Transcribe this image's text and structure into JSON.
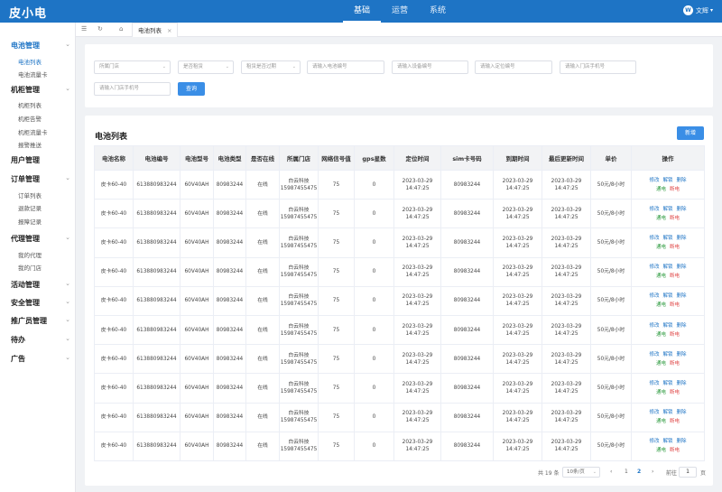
{
  "app": {
    "logo": "皮小电",
    "user": "文辉",
    "user_initial": "W"
  },
  "topnav": [
    "基础",
    "运营",
    "系统"
  ],
  "sidebar": {
    "groups": [
      {
        "label": "电池管理",
        "subs": [
          "电池列表",
          "电池流量卡"
        ]
      },
      {
        "label": "机柜管理",
        "subs": [
          "机柜列表",
          "机柜告警",
          "机柜流量卡",
          "报警推送"
        ]
      },
      {
        "label": "用户管理",
        "subs": []
      },
      {
        "label": "订单管理",
        "subs": [
          "订单列表",
          "退款记录",
          "报障记录"
        ]
      },
      {
        "label": "代理管理",
        "subs": [
          "我的代理",
          "我的门店"
        ]
      },
      {
        "label": "活动管理",
        "subs": []
      },
      {
        "label": "安全管理",
        "subs": []
      },
      {
        "label": "推广员管理",
        "subs": []
      },
      {
        "label": "待办",
        "subs": []
      },
      {
        "label": "广告",
        "subs": []
      }
    ]
  },
  "tabs": {
    "active": "电池列表"
  },
  "filters": {
    "store": "所属门店",
    "rent": "是否租赁",
    "expire": "租赁是否过期",
    "battery_no": "请输入电池编号",
    "device_no": "请输入设备编号",
    "locator_no": "请输入定位编号",
    "store_phone_1": "请输入门店手机号",
    "store_phone_2": "请输入门店手机号",
    "query": "查询"
  },
  "list": {
    "title": "电池列表",
    "add": "新增",
    "columns": [
      "电池名称",
      "电池编号",
      "电池型号",
      "电池类型",
      "是否在线",
      "所属门店",
      "网络信号值",
      "gps星数",
      "定位时间",
      "sim卡号码",
      "到期时间",
      "最后更新时间",
      "单价",
      "操作"
    ],
    "rows": [
      {
        "name": "皮卡60-40",
        "no": "613880983244",
        "model": "60V40AH",
        "type": "80983244",
        "online": "在线",
        "store": "白云科技",
        "store_phone": "15987455475",
        "signal": "75",
        "gps": "0",
        "loc_date": "2023-03-29",
        "loc_time": "14:47:25",
        "sim": "80983244",
        "exp_date": "2023-03-29",
        "exp_time": "14:47:25",
        "upd_date": "2023-03-29",
        "upd_time": "14:47:25",
        "price": "50元/8小时"
      },
      {
        "name": "皮卡60-40",
        "no": "613880983244",
        "model": "60V40AH",
        "type": "80983244",
        "online": "在线",
        "store": "白云科技",
        "store_phone": "15987455475",
        "signal": "75",
        "gps": "0",
        "loc_date": "2023-03-29",
        "loc_time": "14:47:25",
        "sim": "80983244",
        "exp_date": "2023-03-29",
        "exp_time": "14:47:25",
        "upd_date": "2023-03-29",
        "upd_time": "14:47:25",
        "price": "50元/8小时"
      },
      {
        "name": "皮卡60-40",
        "no": "613880983244",
        "model": "60V40AH",
        "type": "80983244",
        "online": "在线",
        "store": "白云科技",
        "store_phone": "15987455475",
        "signal": "75",
        "gps": "0",
        "loc_date": "2023-03-29",
        "loc_time": "14:47:25",
        "sim": "80983244",
        "exp_date": "2023-03-29",
        "exp_time": "14:47:25",
        "upd_date": "2023-03-29",
        "upd_time": "14:47:25",
        "price": "50元/8小时"
      },
      {
        "name": "皮卡60-40",
        "no": "613880983244",
        "model": "60V40AH",
        "type": "80983244",
        "online": "在线",
        "store": "白云科技",
        "store_phone": "15987455475",
        "signal": "75",
        "gps": "0",
        "loc_date": "2023-03-29",
        "loc_time": "14:47:25",
        "sim": "80983244",
        "exp_date": "2023-03-29",
        "exp_time": "14:47:25",
        "upd_date": "2023-03-29",
        "upd_time": "14:47:25",
        "price": "50元/8小时"
      },
      {
        "name": "皮卡60-40",
        "no": "613880983244",
        "model": "60V40AH",
        "type": "80983244",
        "online": "在线",
        "store": "白云科技",
        "store_phone": "15987455475",
        "signal": "75",
        "gps": "0",
        "loc_date": "2023-03-29",
        "loc_time": "14:47:25",
        "sim": "80983244",
        "exp_date": "2023-03-29",
        "exp_time": "14:47:25",
        "upd_date": "2023-03-29",
        "upd_time": "14:47:25",
        "price": "50元/8小时"
      },
      {
        "name": "皮卡60-40",
        "no": "613880983244",
        "model": "60V40AH",
        "type": "80983244",
        "online": "在线",
        "store": "白云科技",
        "store_phone": "15987455475",
        "signal": "75",
        "gps": "0",
        "loc_date": "2023-03-29",
        "loc_time": "14:47:25",
        "sim": "80983244",
        "exp_date": "2023-03-29",
        "exp_time": "14:47:25",
        "upd_date": "2023-03-29",
        "upd_time": "14:47:25",
        "price": "50元/8小时"
      },
      {
        "name": "皮卡60-40",
        "no": "613880983244",
        "model": "60V40AH",
        "type": "80983244",
        "online": "在线",
        "store": "白云科技",
        "store_phone": "15987455475",
        "signal": "75",
        "gps": "0",
        "loc_date": "2023-03-29",
        "loc_time": "14:47:25",
        "sim": "80983244",
        "exp_date": "2023-03-29",
        "exp_time": "14:47:25",
        "upd_date": "2023-03-29",
        "upd_time": "14:47:25",
        "price": "50元/8小时"
      },
      {
        "name": "皮卡60-40",
        "no": "613880983244",
        "model": "60V40AH",
        "type": "80983244",
        "online": "在线",
        "store": "白云科技",
        "store_phone": "15987455475",
        "signal": "75",
        "gps": "0",
        "loc_date": "2023-03-29",
        "loc_time": "14:47:25",
        "sim": "80983244",
        "exp_date": "2023-03-29",
        "exp_time": "14:47:25",
        "upd_date": "2023-03-29",
        "upd_time": "14:47:25",
        "price": "50元/8小时"
      },
      {
        "name": "皮卡60-40",
        "no": "613880983244",
        "model": "60V40AH",
        "type": "80983244",
        "online": "在线",
        "store": "白云科技",
        "store_phone": "15987455475",
        "signal": "75",
        "gps": "0",
        "loc_date": "2023-03-29",
        "loc_time": "14:47:25",
        "sim": "80983244",
        "exp_date": "2023-03-29",
        "exp_time": "14:47:25",
        "upd_date": "2023-03-29",
        "upd_time": "14:47:25",
        "price": "50元/8小时"
      },
      {
        "name": "皮卡60-40",
        "no": "613880983244",
        "model": "60V40AH",
        "type": "80983244",
        "online": "在线",
        "store": "白云科技",
        "store_phone": "15987455475",
        "signal": "75",
        "gps": "0",
        "loc_date": "2023-03-29",
        "loc_time": "14:47:25",
        "sim": "80983244",
        "exp_date": "2023-03-29",
        "exp_time": "14:47:25",
        "upd_date": "2023-03-29",
        "upd_time": "14:47:25",
        "price": "50元/8小时"
      }
    ],
    "actions": {
      "edit": "修改",
      "unlock": "解锁",
      "delete": "删除",
      "power_on": "通电",
      "power_off": "断电"
    }
  },
  "pagination": {
    "total": "共 19 条",
    "page_size": "10条/页",
    "pages": [
      "1",
      "2"
    ],
    "current": "2",
    "goto_label": "前往",
    "goto_value": "1",
    "goto_suffix": "页"
  },
  "colors": {
    "primary": "#1e74c5",
    "button": "#3a8ee6",
    "green": "#2c9a3e",
    "red": "#e04a4a"
  }
}
